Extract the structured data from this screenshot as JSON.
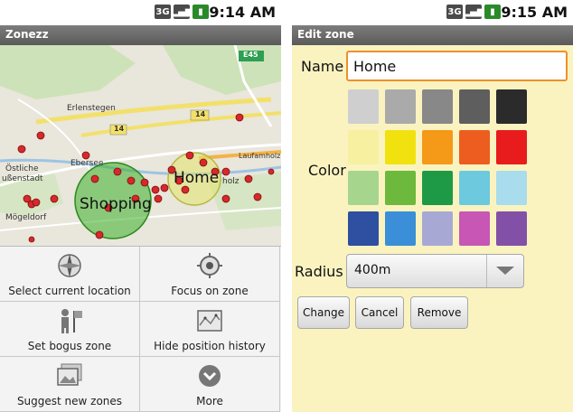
{
  "left": {
    "status_time": "9:14 AM",
    "status_icons": [
      "3G",
      "signal",
      "battery"
    ],
    "title": "Zonezz",
    "map": {
      "labels": [
        "Erlenstegen",
        "Östliche",
        "ußenstadt",
        "Ebersee",
        "Mögeldorf",
        "Laufamholz",
        "holz",
        "E45",
        "14",
        "14"
      ],
      "zones": [
        {
          "name": "Shopping",
          "color": "#3cae2a"
        },
        {
          "name": "Home",
          "color": "#d8e06a"
        }
      ]
    },
    "menu": [
      {
        "label": "Select current location",
        "icon": "compass-icon"
      },
      {
        "label": "Focus on zone",
        "icon": "target-icon"
      },
      {
        "label": "Set bogus zone",
        "icon": "person-flag-icon"
      },
      {
        "label": "Hide position history",
        "icon": "map-icon"
      },
      {
        "label": "Suggest new zones",
        "icon": "gallery-icon"
      },
      {
        "label": "More",
        "icon": "more-icon"
      }
    ]
  },
  "right": {
    "status_time": "9:15 AM",
    "status_icons": [
      "3G",
      "signal",
      "battery"
    ],
    "title": "Edit zone",
    "name_label": "Name",
    "name_value": "Home",
    "color_label": "Color",
    "colors": [
      [
        "#cfcfcf",
        "#aaaaaa",
        "#888888",
        "#5e5e5e",
        "#2b2b2b"
      ],
      [
        "#f7f0a0",
        "#f1e20f",
        "#f49918",
        "#ee5d20",
        "#e81c1c"
      ],
      [
        "#a6d68d",
        "#6cb93d",
        "#1e9a46",
        "#6cc9de",
        "#a9dcec"
      ],
      [
        "#2f4fa0",
        "#3a8fd8",
        "#a7a9d4",
        "#c756b4",
        "#8350a8"
      ]
    ],
    "radius_label": "Radius",
    "radius_value": "400m",
    "buttons": {
      "change": "Change",
      "cancel": "Cancel",
      "remove": "Remove"
    }
  }
}
